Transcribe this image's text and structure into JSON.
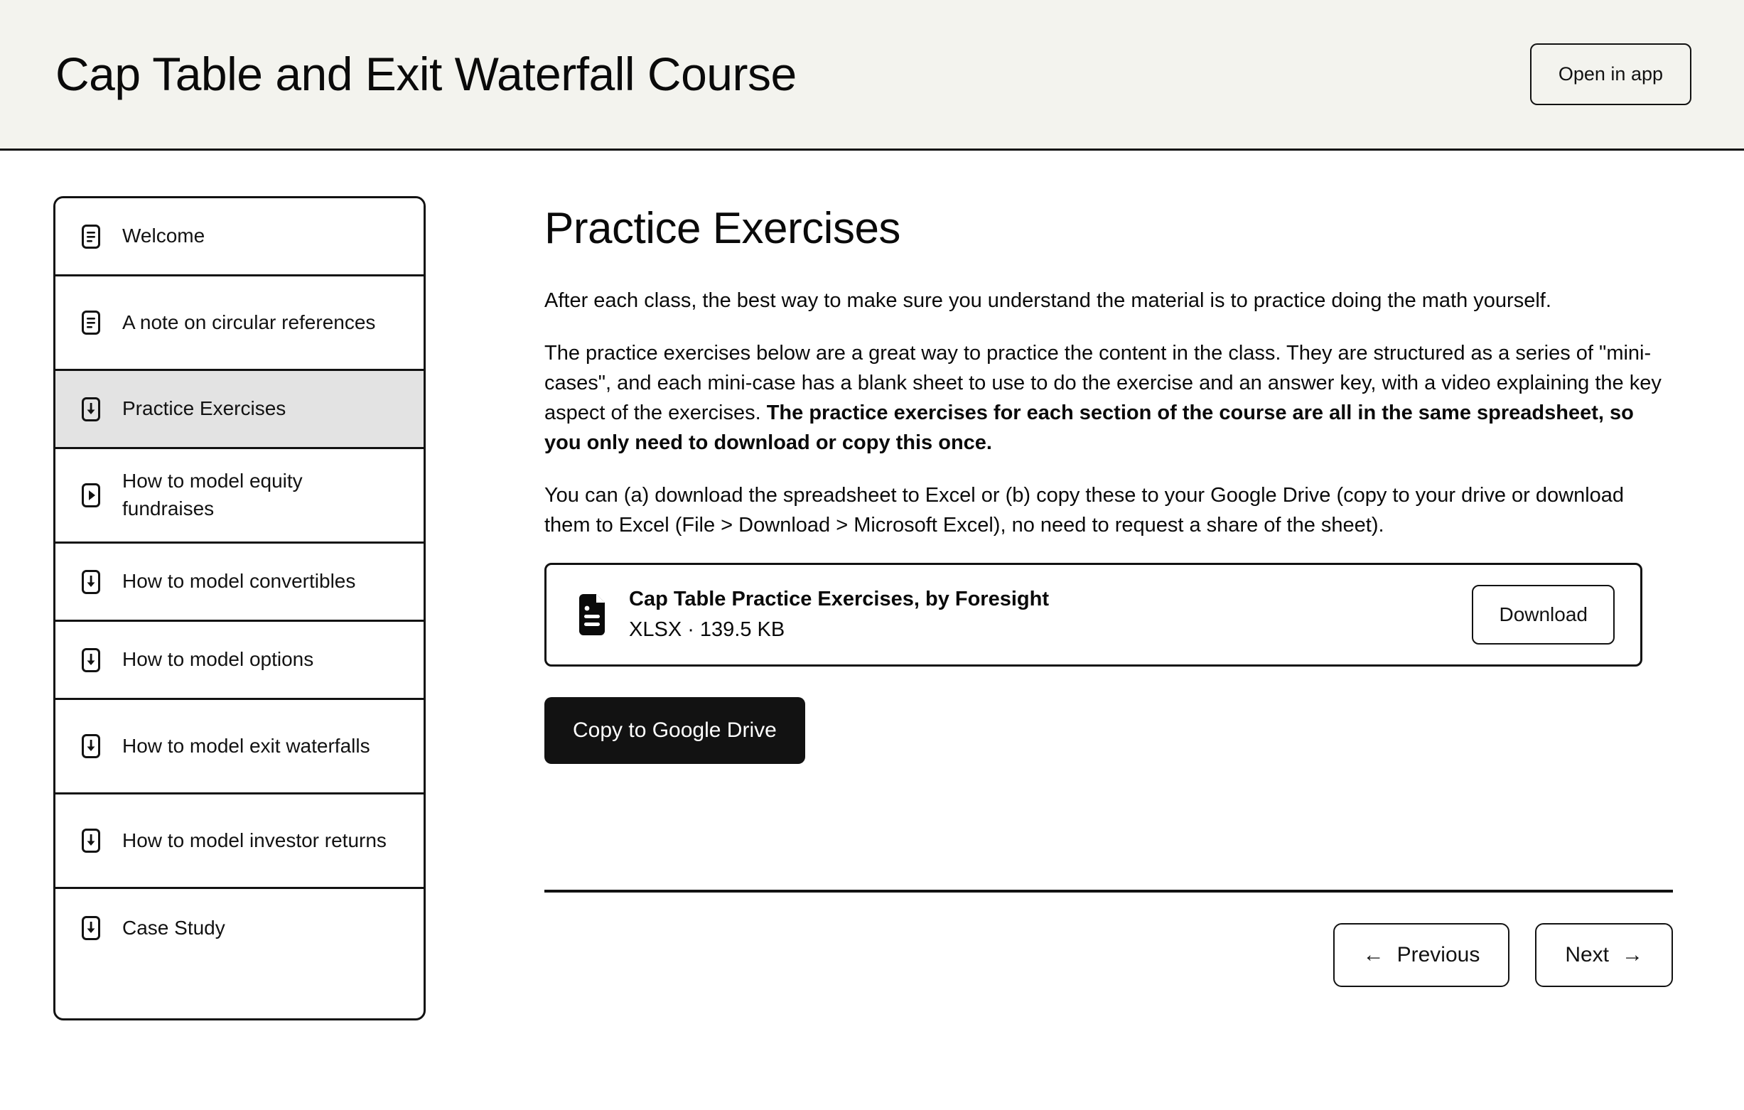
{
  "header": {
    "title": "Cap Table and Exit Waterfall Course",
    "open_in_app_label": "Open in app",
    "background_color": "#f3f3ee"
  },
  "sidebar": {
    "items": [
      {
        "label": "Welcome",
        "icon": "document-icon",
        "active": false
      },
      {
        "label": "A note on circular references",
        "icon": "document-icon",
        "active": false
      },
      {
        "label": "Practice Exercises",
        "icon": "download-icon",
        "active": true
      },
      {
        "label": "How to model equity fundraises",
        "icon": "video-play-icon",
        "active": false
      },
      {
        "label": "How to model convertibles",
        "icon": "download-icon",
        "active": false
      },
      {
        "label": "How to model options",
        "icon": "download-icon",
        "active": false
      },
      {
        "label": "How to model exit waterfalls",
        "icon": "download-icon",
        "active": false
      },
      {
        "label": "How to model investor returns",
        "icon": "download-icon",
        "active": false
      },
      {
        "label": "Case Study",
        "icon": "download-icon",
        "active": false
      }
    ],
    "active_background_color": "#e3e3e3"
  },
  "main": {
    "title": "Practice Exercises",
    "paragraph_1": "After each class, the best way to make sure you understand the material is to practice doing the math yourself.",
    "paragraph_2_lead": "The practice exercises below are a great way to practice the content in the class. They are structured as a series of \"mini-cases\", and each mini-case has a blank sheet to use to do the exercise and an answer key, with a video explaining the key aspect of the exercises. ",
    "paragraph_2_bold": "The practice exercises for each section of the course are all in the same spreadsheet, so you only need to download or copy this once.",
    "paragraph_3": "You can (a) download the spreadsheet to Excel or (b) copy these to your Google Drive (copy to your drive or download them to Excel (File > Download > Microsoft Excel), no need to request a share of the sheet).",
    "file_card": {
      "name": "Cap Table Practice Exercises, by Foresight",
      "meta": "XLSX · 139.5 KB",
      "download_label": "Download",
      "icon": "file-document-icon"
    },
    "google_drive_button_label": "Copy to Google Drive",
    "nav": {
      "previous_label": "Previous",
      "previous_arrow": "←",
      "next_label": "Next",
      "next_arrow": "→"
    }
  }
}
